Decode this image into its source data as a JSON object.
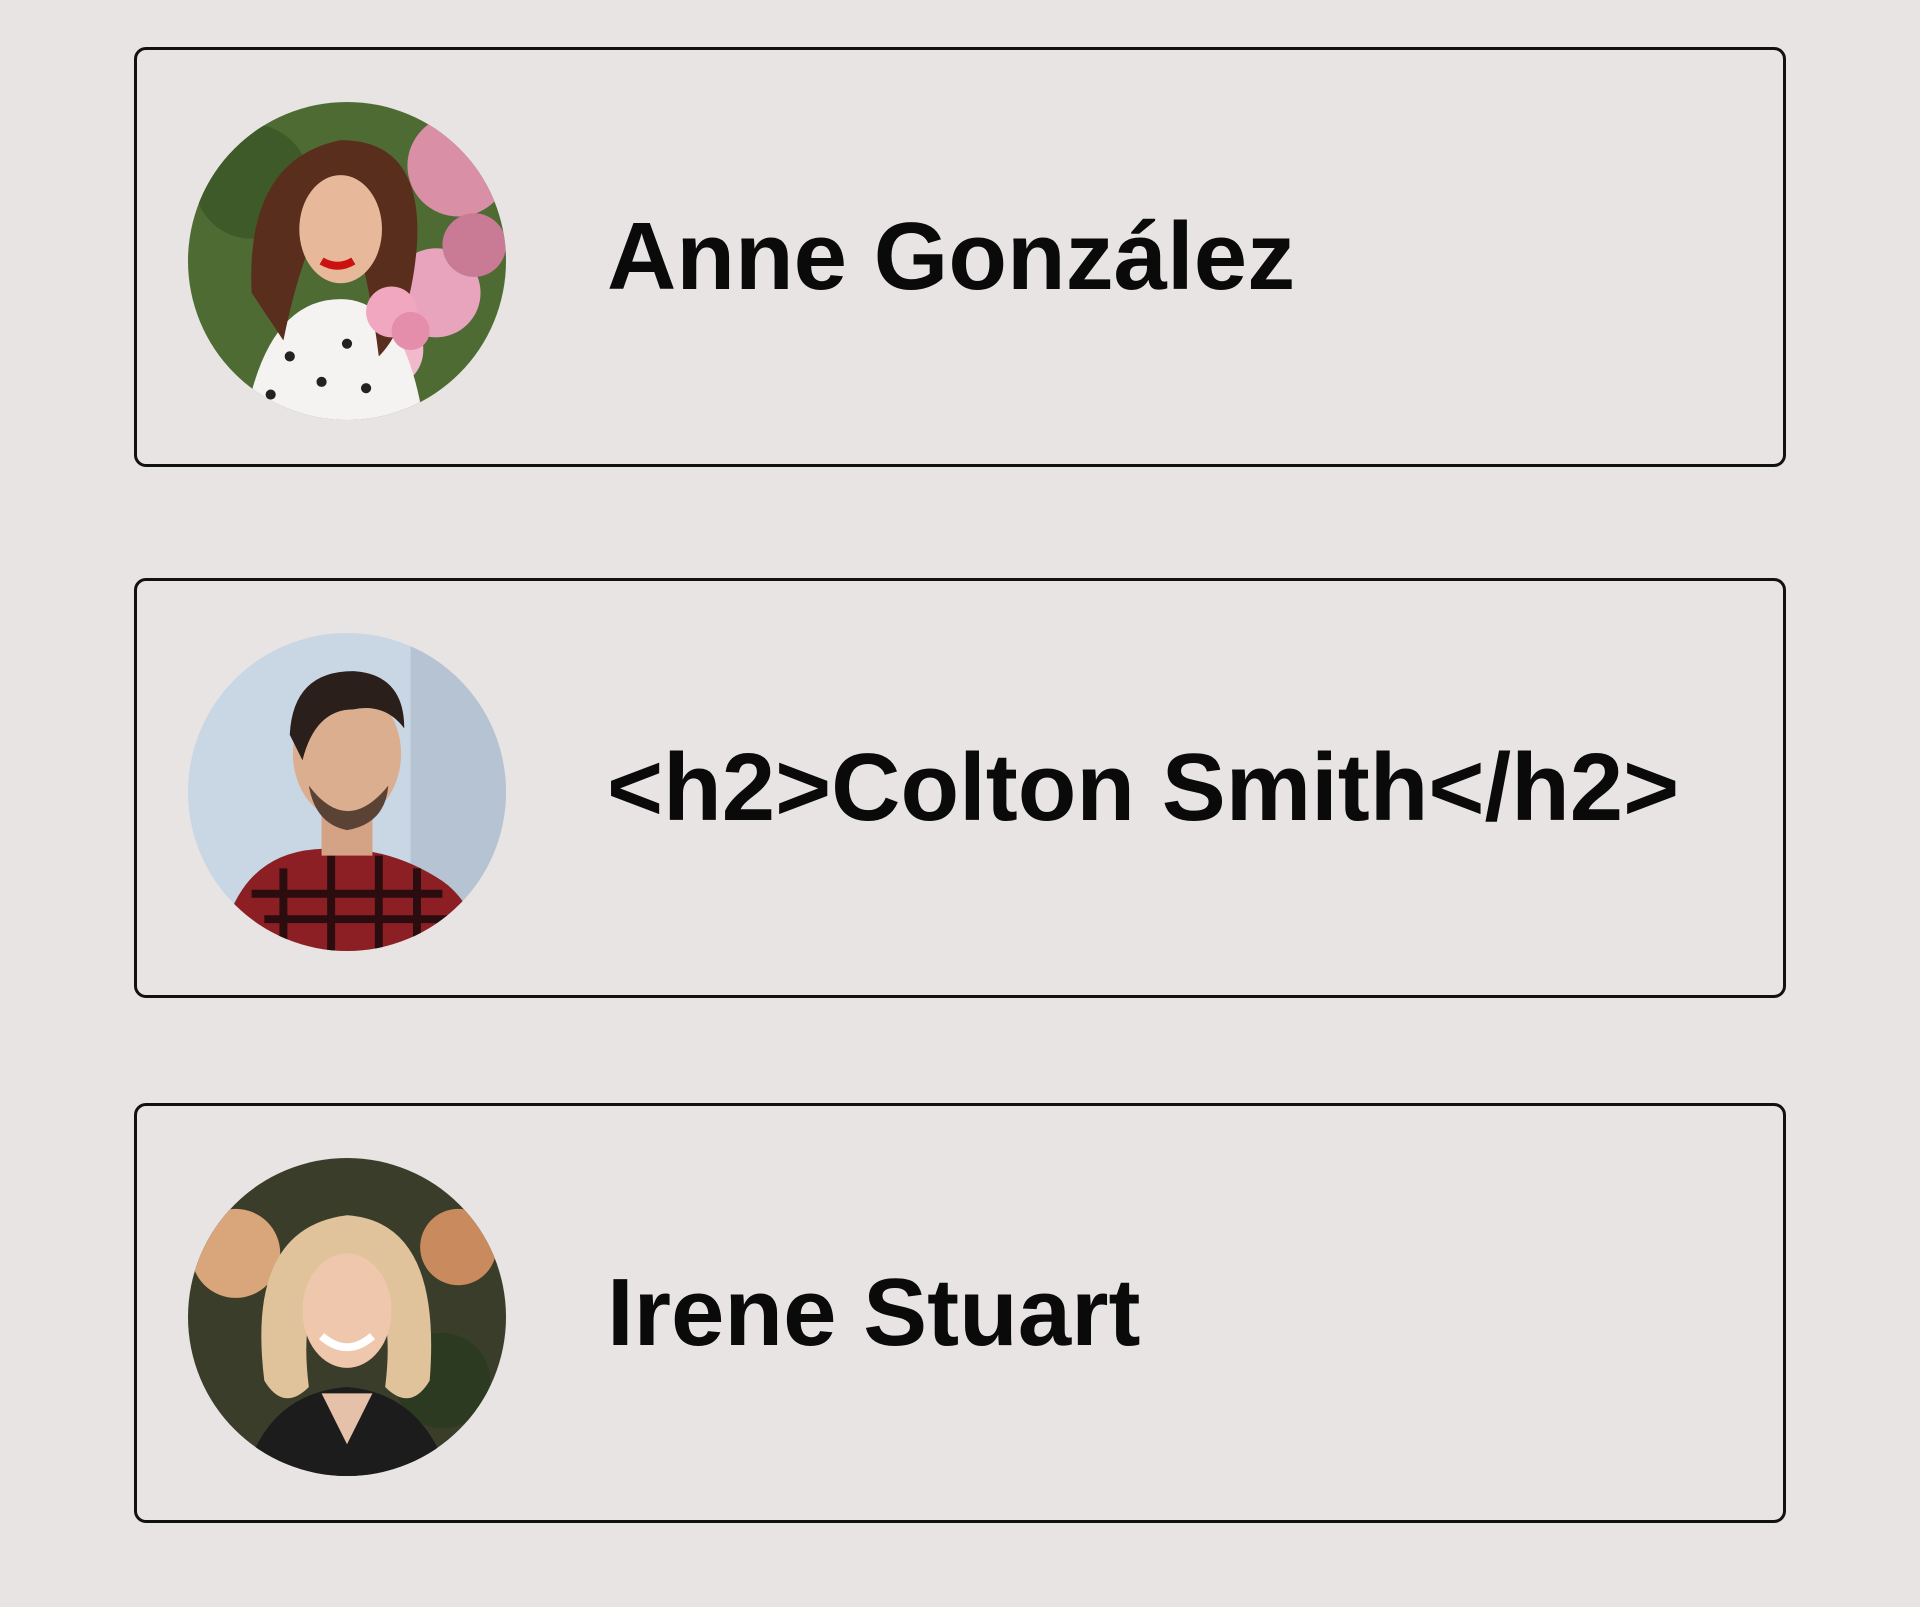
{
  "people": [
    {
      "name": "Anne González",
      "avatar_icon": "person-photo-woman-flowers"
    },
    {
      "name": "<h2>Colton Smith</h2>",
      "avatar_icon": "person-photo-man-plaid-shirt"
    },
    {
      "name": "Irene Stuart",
      "avatar_icon": "person-photo-woman-blonde"
    }
  ]
}
